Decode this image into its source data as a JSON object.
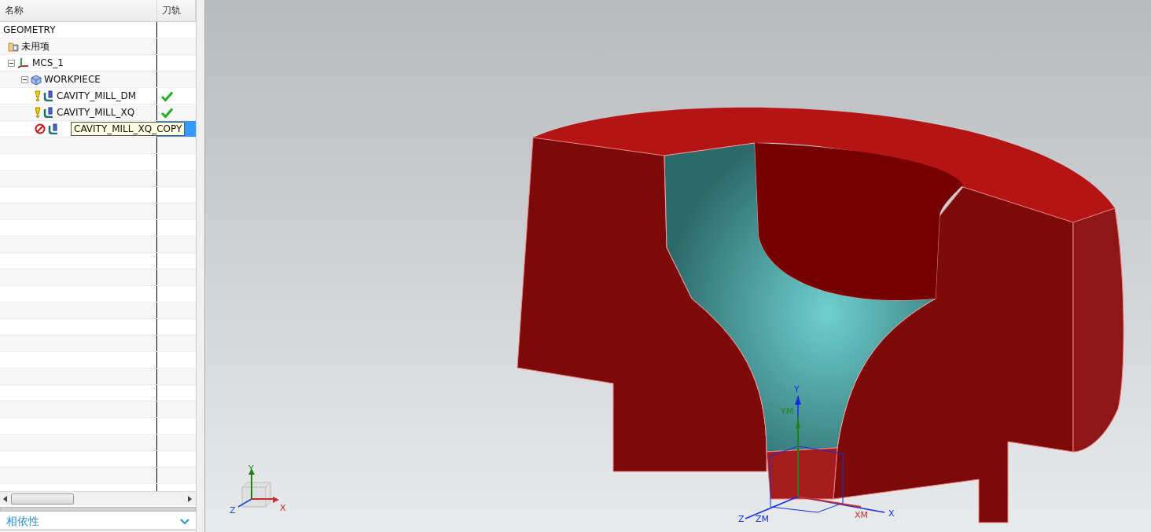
{
  "navigator": {
    "columns": [
      "名称",
      "刀轨"
    ],
    "tree": [
      {
        "label": "GEOMETRY",
        "children": [
          {
            "label": "未用项",
            "kind": "folder"
          },
          {
            "label": "MCS_1",
            "kind": "mcs",
            "expanded": true,
            "children": [
              {
                "label": "WORKPIECE",
                "kind": "workpiece",
                "expanded": true,
                "children": [
                  {
                    "label": "CAVITY_MILL_DM",
                    "kind": "operation",
                    "blocked": false,
                    "toolpath_ok": true,
                    "selected": false
                  },
                  {
                    "label": "CAVITY_MILL_XQ",
                    "kind": "operation",
                    "blocked": false,
                    "toolpath_ok": true,
                    "selected": false
                  },
                  {
                    "label": "CAVITY_MILL_XQ_COPY",
                    "kind": "operation",
                    "blocked": true,
                    "toolpath_ok": false,
                    "selected": true
                  }
                ]
              }
            ]
          }
        ]
      }
    ]
  },
  "dependencies_panel": {
    "title": "相依性",
    "expanded": false
  },
  "viewport": {
    "view_triad": [
      "Y",
      "Z",
      "X"
    ],
    "wcs_axes": [
      "Y",
      "YM",
      "Z",
      "ZM",
      "XM",
      "X"
    ]
  }
}
